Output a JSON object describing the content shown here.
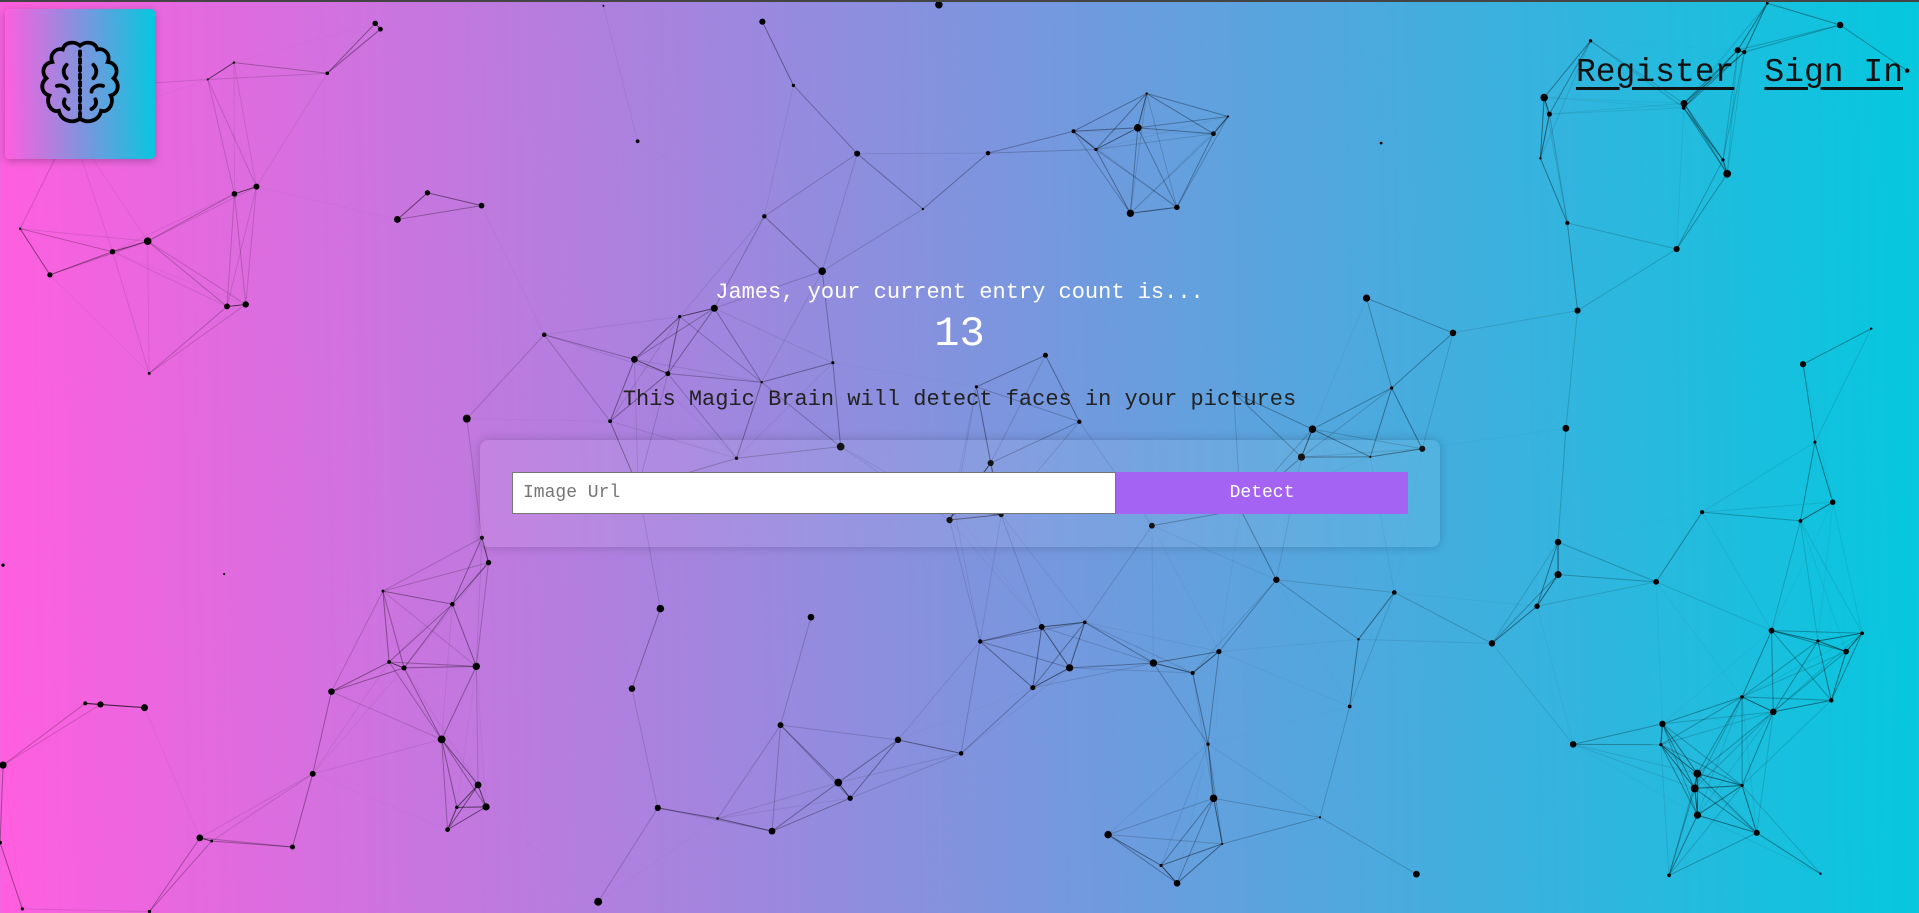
{
  "logo": {
    "icon": "brain-icon"
  },
  "nav": {
    "register": "Register",
    "sign_in": "Sign In"
  },
  "rank": {
    "greeting": "James, your current entry count is...",
    "count": "13"
  },
  "form": {
    "tagline": "This Magic Brain will detect faces in your pictures",
    "placeholder": "Image Url",
    "value": "",
    "button": "Detect"
  },
  "colors": {
    "gradient_start": "#ff5edf",
    "gradient_end": "#04c8de",
    "button": "#a463f2"
  }
}
